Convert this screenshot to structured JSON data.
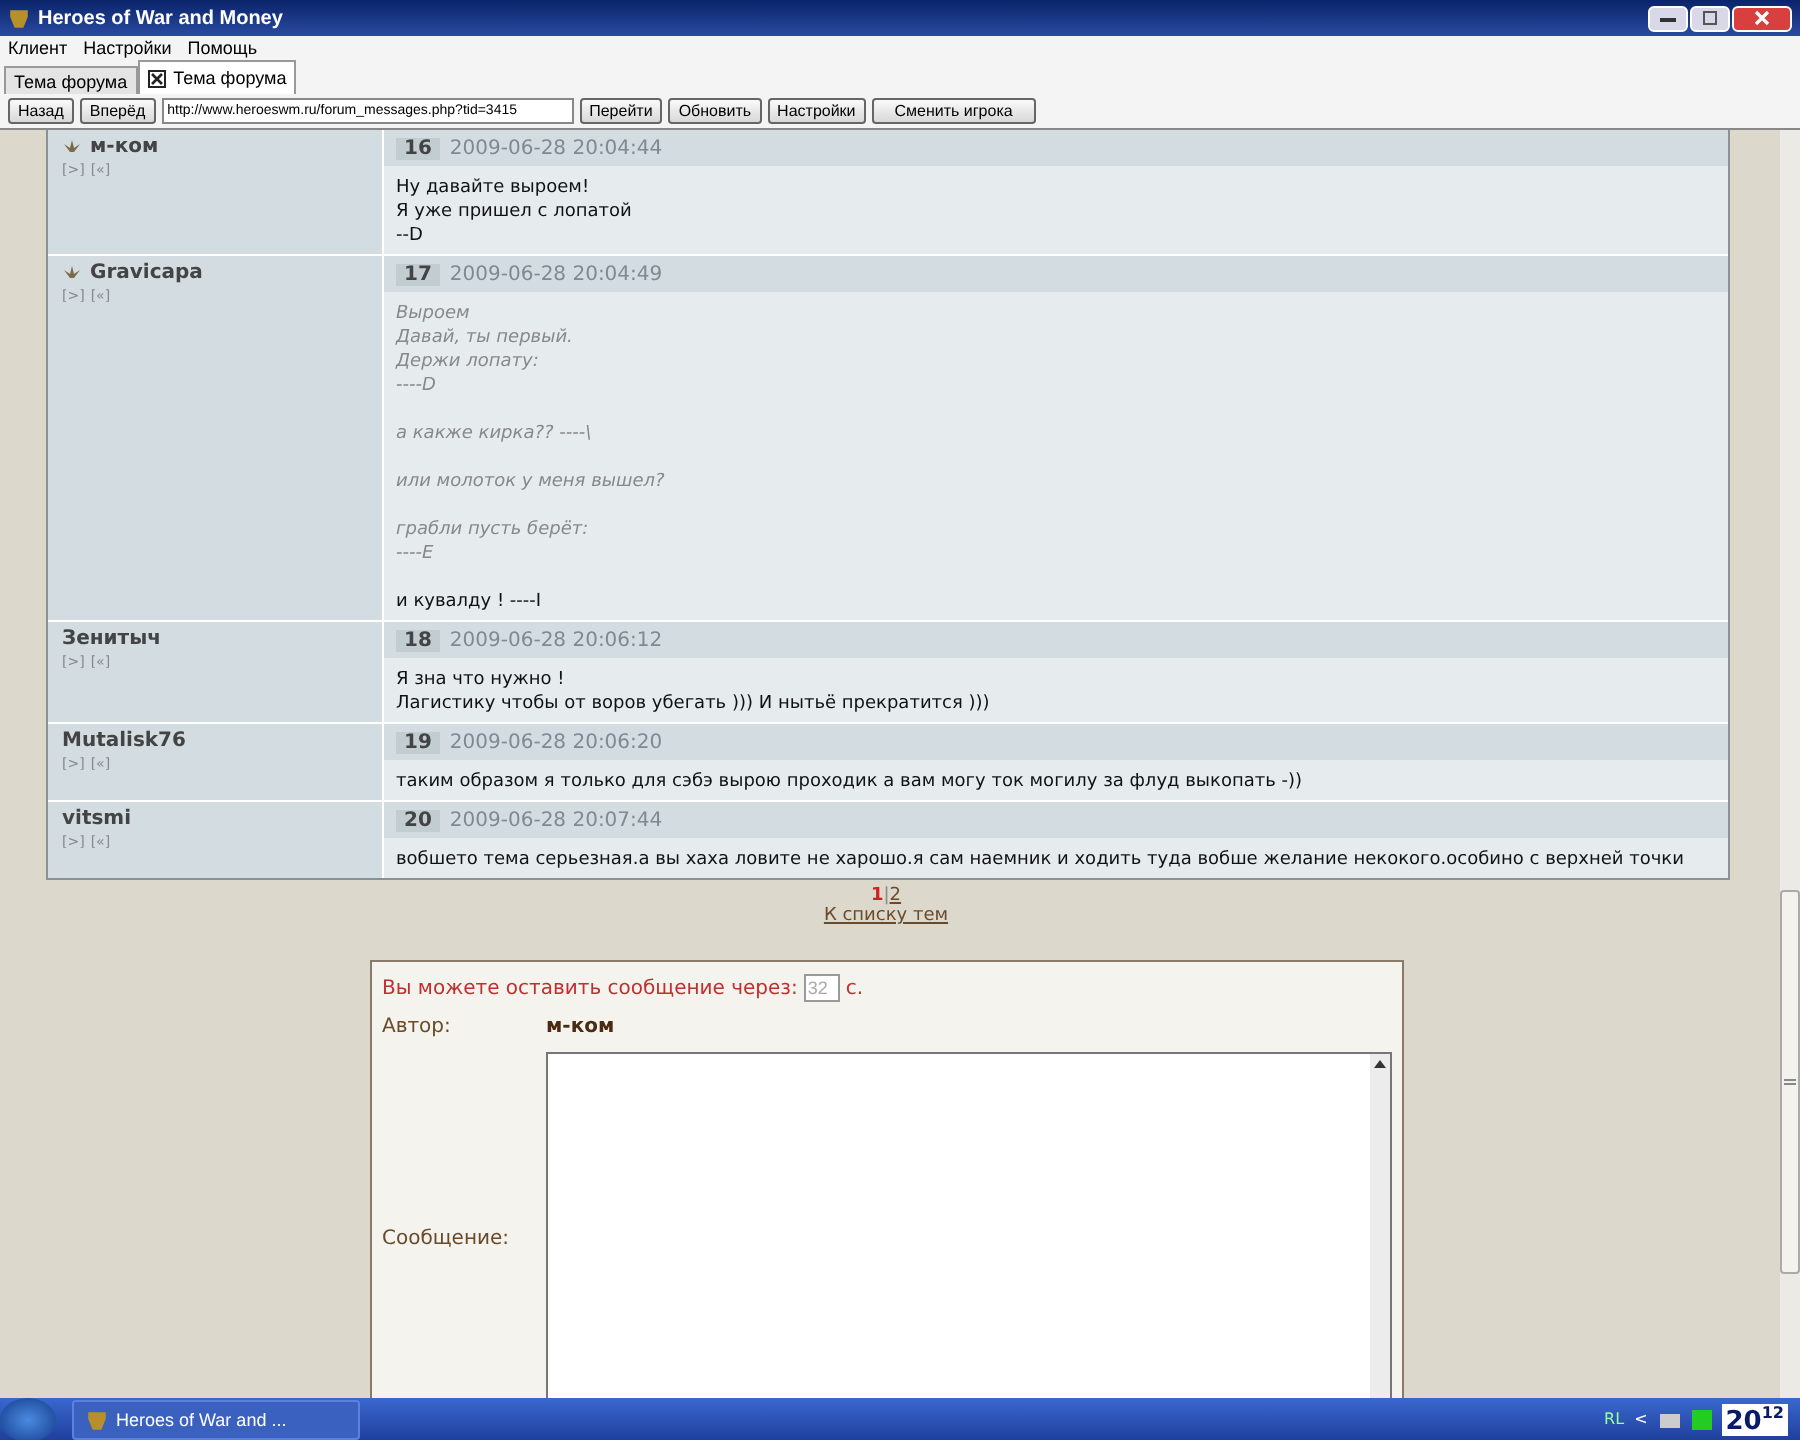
{
  "window": {
    "title": "Heroes of War and Money"
  },
  "menu": [
    "Клиент",
    "Настройки",
    "Помощь"
  ],
  "tabs": [
    {
      "label": "Тема форума",
      "selected": false,
      "closable": false
    },
    {
      "label": "Тема форума",
      "selected": true,
      "closable": true
    }
  ],
  "toolbar": {
    "buttons_left": [
      "Назад",
      "Вперёд"
    ],
    "url": "http://www.heroeswm.ru/forum_messages.php?tid=3415",
    "buttons_right": [
      "Перейти",
      "Обновить",
      "Настройки",
      "Сменить игрока"
    ]
  },
  "posts": [
    {
      "author": "м-ком",
      "has_icon": true,
      "links": [
        "[>]",
        "[«]"
      ],
      "number": "16",
      "date": "2009-06-28 20:04:44",
      "lines": [
        {
          "kind": "text",
          "text": "Ну давайте выроем!"
        },
        {
          "kind": "text",
          "text": "Я уже пришел с лопатой"
        },
        {
          "kind": "text",
          "text": "--D"
        }
      ]
    },
    {
      "author": "Gravicapa",
      "has_icon": true,
      "links": [
        "[>]",
        "[«]"
      ],
      "number": "17",
      "date": "2009-06-28 20:04:49",
      "lines": [
        {
          "kind": "quote",
          "text": "Выроем"
        },
        {
          "kind": "quote",
          "text": "Давай, ты первый."
        },
        {
          "kind": "quote",
          "text": "Держи лопату:"
        },
        {
          "kind": "quote",
          "text": "----D"
        },
        {
          "kind": "blank"
        },
        {
          "kind": "quote",
          "text": "а какже кирка?? ----\\"
        },
        {
          "kind": "blank"
        },
        {
          "kind": "quote",
          "text": "или молоток у меня вышел?"
        },
        {
          "kind": "blank"
        },
        {
          "kind": "quote",
          "text": "грабли пусть берёт:"
        },
        {
          "kind": "quote",
          "text": "----E"
        },
        {
          "kind": "blank"
        },
        {
          "kind": "text",
          "text": "и кувалду ! ----I"
        }
      ]
    },
    {
      "author": "Зенитыч",
      "has_icon": false,
      "links": [
        "[>]",
        "[«]"
      ],
      "number": "18",
      "date": "2009-06-28 20:06:12",
      "lines": [
        {
          "kind": "text",
          "text": "Я зна что нужно !"
        },
        {
          "kind": "text",
          "text": "Лагистику чтобы от воров убегать ))) И нытьё прекратится )))"
        }
      ]
    },
    {
      "author": "Mutalisk76",
      "has_icon": false,
      "links": [
        "[>]",
        "[«]"
      ],
      "number": "19",
      "date": "2009-06-28 20:06:20",
      "lines": [
        {
          "kind": "text",
          "text": "таким образом я только для сэбэ вырою проходик а вам могу ток могилу за флуд выкопать -))"
        }
      ]
    },
    {
      "author": "vitsmi",
      "has_icon": false,
      "links": [
        "[>]",
        "[«]"
      ],
      "number": "20",
      "date": "2009-06-28 20:07:44",
      "lines": [
        {
          "kind": "text",
          "text": "вобшето тема серьезная.а вы хаха ловите не харошо.я сам наемник и ходить туда вобше желание некокого.особино с верхней точки"
        }
      ]
    }
  ],
  "pagination": {
    "pages": [
      {
        "label": "1",
        "selected": true
      },
      {
        "label": "2",
        "selected": false
      }
    ],
    "separator": "|",
    "back_link": "К списку тем"
  },
  "reply_form": {
    "notice": "Вы можете оставить сообщение через:",
    "countdown": "32",
    "unit": "с.",
    "author_label": "Автор:",
    "author": "м-ком",
    "message_label": "Сообщение:"
  },
  "taskbar": {
    "task": "Heroes of War and ...",
    "lang": "RL",
    "tray_arrow": "<",
    "clock": "20$^{12}$"
  }
}
